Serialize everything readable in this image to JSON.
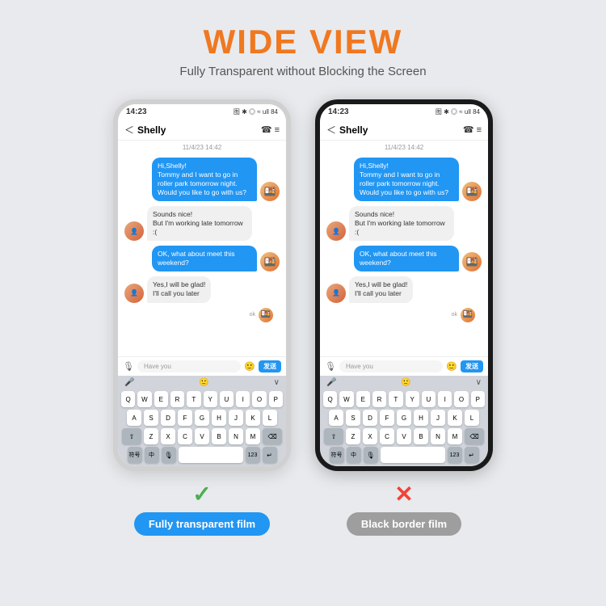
{
  "header": {
    "title": "WIDE VIEW",
    "subtitle": "Fully Transparent without Blocking the Screen"
  },
  "phones": [
    {
      "id": "left",
      "type": "transparent",
      "border": "light",
      "statusTime": "14:23",
      "statusIcons": "图 * ◎ ≈ ull 84",
      "chatName": "Shelly",
      "chatDate": "11/4/23 14:42",
      "messages": [
        {
          "type": "sent",
          "text": "Hi,Shelly!\nTommy and I want to go in roller park tomorrow night. Would you like to go with us?"
        },
        {
          "type": "received",
          "text": "Sounds nice!\nBut I'm working late tomorrow :("
        },
        {
          "type": "sent",
          "text": "OK, what about meet this weekend?"
        },
        {
          "type": "received",
          "text": "Yes,I will be glad!\nI'll call you later"
        }
      ],
      "inputPlaceholder": "Have you",
      "sendLabel": "发送",
      "label": "Fully transparent film",
      "labelColor": "blue",
      "check": "✓",
      "checkColor": "green"
    },
    {
      "id": "right",
      "type": "black-border",
      "border": "dark",
      "statusTime": "14:23",
      "statusIcons": "图 * ◎ ≈ ull 84",
      "chatName": "Shelly",
      "chatDate": "11/4/23 14:42",
      "messages": [
        {
          "type": "sent",
          "text": "Hi,Shelly!\nTommy and I want to go in roller park tomorrow night. Would you like to go with us?"
        },
        {
          "type": "received",
          "text": "Sounds nice!\nBut I'm working late tomorrow :("
        },
        {
          "type": "sent",
          "text": "OK, what about meet this weekend?"
        },
        {
          "type": "received",
          "text": "Yes,I will be glad!\nI'll call you later"
        }
      ],
      "inputPlaceholder": "Have you",
      "sendLabel": "发送",
      "label": "Black border film",
      "labelColor": "gray",
      "check": "✕",
      "checkColor": "red"
    }
  ],
  "keyboard": {
    "rows": [
      [
        "Q",
        "W",
        "E",
        "R",
        "T",
        "Y",
        "U",
        "I",
        "O",
        "P"
      ],
      [
        "A",
        "S",
        "D",
        "F",
        "G",
        "H",
        "J",
        "K",
        "L"
      ],
      [
        "Z",
        "X",
        "C",
        "V",
        "B",
        "N",
        "M"
      ]
    ]
  }
}
